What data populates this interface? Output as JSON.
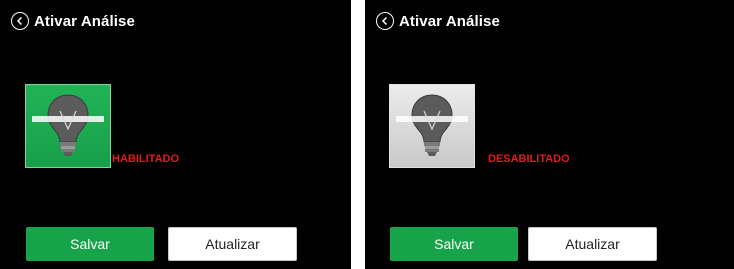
{
  "panels": [
    {
      "title": "Ativar Análise",
      "status": "HABILITADO",
      "save_label": "Salvar",
      "refresh_label": "Atualizar",
      "state": "enabled"
    },
    {
      "title": "Ativar Análise",
      "status": "DESABILITADO",
      "save_label": "Salvar",
      "refresh_label": "Atualizar",
      "state": "disabled"
    }
  ],
  "icons": {
    "back": "back-circle-icon",
    "bulb": "lightbulb-icon"
  },
  "colors": {
    "background": "#000000",
    "title": "#ffffff",
    "status": "#e31b1b",
    "save_button": "#16a34a",
    "enabled_tile": "#1fae53",
    "disabled_tile": "#d8d8d8"
  }
}
